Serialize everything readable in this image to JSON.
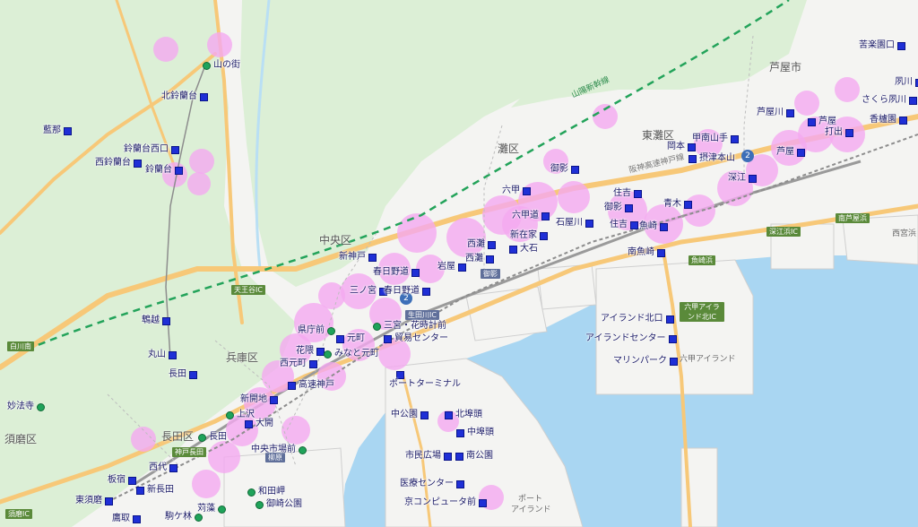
{
  "colors": {
    "sea": "#a9d6f2",
    "land": "#f4f4f2",
    "green": "#dcefd6",
    "road": "#f7c878",
    "coverage": "#f4a9f0",
    "station": "#1f2fd6",
    "station_alt": "#1fa35a",
    "shinkansen": "#23a35a"
  },
  "areas": {
    "ashiya": "芦屋市",
    "higashinada": "東灘区",
    "nada": "灘区",
    "chuo": "中央区",
    "hyogo": "兵庫区",
    "nagata": "長田区",
    "suma": "須磨区"
  },
  "lines": {
    "sanyo_shinkansen": "山陽新幹線",
    "hanshin_expressway": "阪神高速神戸線"
  },
  "road_signs": {
    "tenjindani_ic": "天王谷IC",
    "shirakawa": "白川南",
    "kobe_nagata": "神戸長田",
    "ikuta": "生田川IC",
    "kamisawa": "柳原",
    "fukae_hama": "深江浜IC",
    "ashiyahama": "南芦屋浜",
    "uozaki_hama": "魚崎浜",
    "rokko_island_kita": "六甲アイランド北IC",
    "suma_ic": "須磨IC",
    "mikage": "御影"
  },
  "sub_labels": {
    "nishinomiya_hama": "西宮浜",
    "rokko_island": "六甲アイランド",
    "port_island_1": "ポート",
    "port_island_2": "アイランド"
  },
  "badges": {
    "b1": "2",
    "b2": "2"
  },
  "stations": {
    "yamanomachi": "山の街",
    "kitasuzurandai": "北鈴蘭台",
    "aino": "藍那",
    "suzurandai_nishi": "鈴蘭台西口",
    "nishisuzurandai": "西鈴蘭台",
    "suzurandai": "鈴蘭台",
    "kusutani": "鵯越",
    "maruyama": "丸山",
    "nagata_k": "長田",
    "minatogawa": "妙法寺",
    "shin_kobe": "新神戸",
    "kasuganomichi": "春日野道",
    "sannomiya": "三ノ宮",
    "kasuganomichi2": "春日野道",
    "iwaya": "岩屋",
    "nishinada": "西灘",
    "shinzaike": "新在家",
    "ooishi": "大石",
    "rokko": "六甲",
    "rokkomichi": "六甲道",
    "ishiyagawa": "石屋川",
    "mikage": "御影",
    "sumiyoshi": "住吉",
    "sumiyoshi2": "住吉",
    "uozaki": "魚崎",
    "minamiuozaki": "南魚崎",
    "okamoto": "岡本",
    "setsutsu_motoyama": "摂津本山",
    "konan_yamate": "甲南山手",
    "fukae": "深江",
    "aoki": "青木",
    "ashiyagawa": "芦屋川",
    "ashiya": "芦屋",
    "uchide": "打出",
    "kouyouen": "苦楽園口",
    "shukugawa": "夙川",
    "sakura_shukugawa": "さくら夙川",
    "koroen": "香櫨園",
    "ashiya_h": "芦屋",
    "sannomiya_hanadokei": "三宮・花時計前",
    "kencho": "県庁前",
    "motomachi": "元町",
    "hanakuma": "花隈",
    "minatomotomachi": "みなと元町",
    "boeki": "貿易センター",
    "nishimotomachi": "西元町",
    "kosoku_kobe": "高速神戸",
    "port_terminal": "ポートターミナル",
    "naka_koen": "中公園",
    "kitafuto": "北埠頭",
    "nakafuto": "中埠頭",
    "shimin_hiroba": "市民広場",
    "minami_koen": "南公園",
    "iryo_center": "医療センター",
    "kyoto_computer": "京コンピュータ前",
    "shinkaichi": "新開地",
    "kamisawa": "上沢",
    "daikai": "大開",
    "nagata2": "長田",
    "chuo_ichiba": "中央市場前",
    "nishidai": "西代",
    "itayado": "板宿",
    "shin_nagata": "新長田",
    "higashisuma": "東須磨",
    "wadamisaki": "和田岬",
    "mikura": "御崎公園",
    "karumo": "苅藻",
    "komagabayashi": "駒ケ林",
    "takatori": "鷹取",
    "rokko_island_kita": "アイランド北口",
    "island_center": "アイランドセンター",
    "marine_park": "マリンパーク"
  }
}
